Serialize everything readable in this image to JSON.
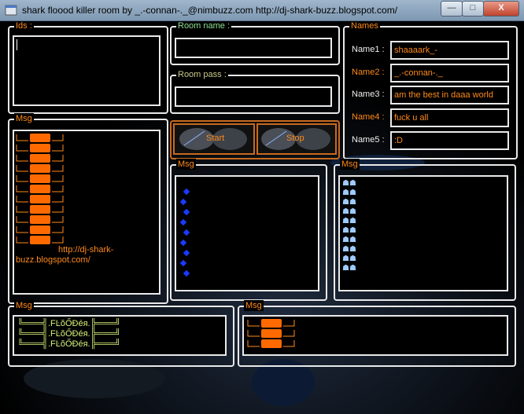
{
  "titlebar": {
    "title": "shark floood killer room by _.-connan-._@nimbuzz.com  http://dj-shark-buzz.blogspot.com/",
    "minimize_glyph": "—",
    "maximize_glyph": "□",
    "close_glyph": "X"
  },
  "ids": {
    "legend": "Ids :"
  },
  "room_name": {
    "legend": "Room name :",
    "value": ""
  },
  "room_pass": {
    "legend": "Room pass :",
    "value": ""
  },
  "names": {
    "legend": "Names",
    "rows": [
      {
        "label": "Name1 :",
        "value": "shaaaark_-"
      },
      {
        "label": "Name2 :",
        "value": "_.-connan-._"
      },
      {
        "label": "Name3 :",
        "value": "am the best in daaa world"
      },
      {
        "label": "Name4 :",
        "value": "fuck u all"
      },
      {
        "label": "Name5 :",
        "value": ":D"
      }
    ]
  },
  "buttons": {
    "start": "Start",
    "stop": "Stop"
  },
  "msg_left": {
    "legend": "Msg",
    "link_line1": "http://dj-shark-",
    "link_line2": "buzz.blogspot.com/"
  },
  "msg_center": {
    "legend": "Msg"
  },
  "msg_right": {
    "legend": "Msg"
  },
  "msg_bottom_left": {
    "legend": "Msg",
    "lines": [
      "╚═══╣.FĿŏŐĐéя.╠═══╝",
      "╚═══╣.FĿŏŐĐéя.╠═══╝",
      "╚═══╣.FĿŏŐĐéя.╠═══╝"
    ]
  },
  "msg_bottom_right": {
    "legend": "Msg"
  },
  "colors": {
    "accent_orange": "#ff8a1a",
    "ornament_orange": "#ff6a00",
    "border": "#e9e9e9",
    "flood_text": "#d7f27a"
  }
}
